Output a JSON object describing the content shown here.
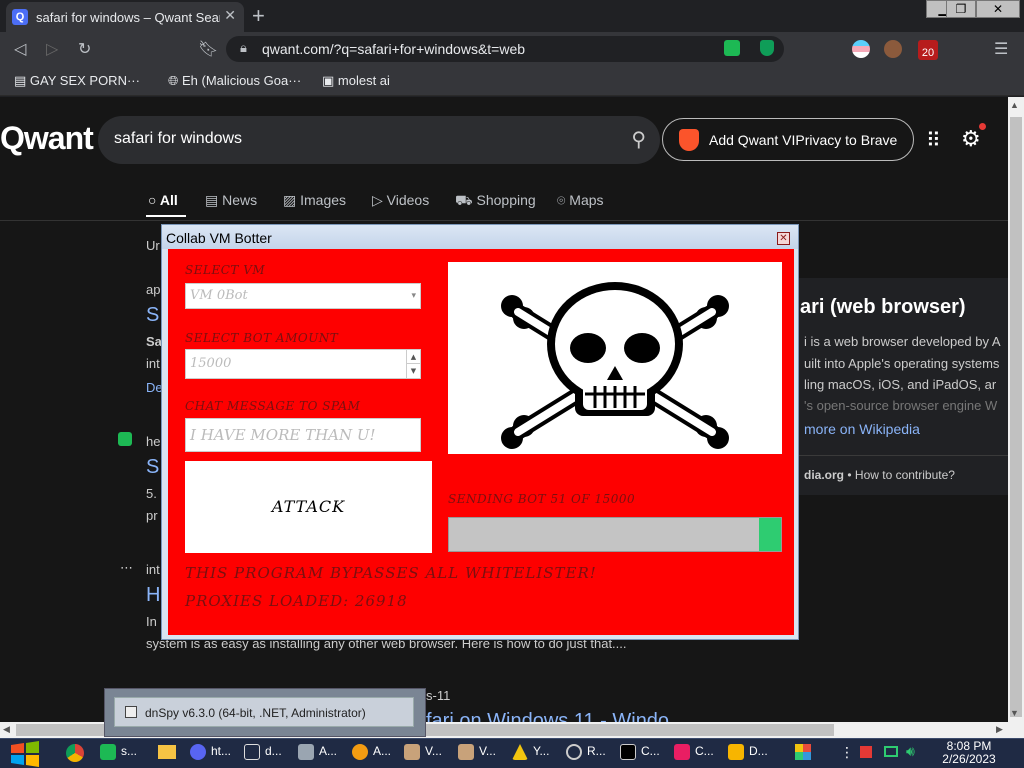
{
  "browser": {
    "tab_title": "safari for windows – Qwant Sear",
    "tab_favicon": "Q",
    "url": "qwant.com/?q=safari+for+windows&t=web",
    "badge_count": "20",
    "bookmarks": [
      "GAY SEX PORN···",
      "Eh (Malicious Goa···",
      "molest ai"
    ]
  },
  "page": {
    "logo": "Qwant",
    "search_query": "safari for windows",
    "brave_button": "Add Qwant VIPrivacy to Brave",
    "tabs": [
      "All",
      "News",
      "Images",
      "Videos",
      "Shopping",
      "Maps"
    ],
    "results": {
      "r0_label": "Ur",
      "r1_source": "ap",
      "r1_title": "S",
      "r1_snip1": "Sa",
      "r1_snip2": "int",
      "r1_snip3": "De",
      "r2_source": "he",
      "r2_title": "S",
      "r2_snip1": "5.",
      "r2_snip2": "pr",
      "r3_source": "int",
      "r3_title": "H",
      "r3_snip1": "In",
      "r3_snip2": "system is as easy as installing any other web browser. Here is how to do just that....",
      "r4_source": "s-11",
      "r4_title": "fari on Windows 11 - Windo"
    },
    "knowledge_panel": {
      "title": "ari (web browser)",
      "lines": [
        "i is a web browser developed by A",
        "uilt into Apple's operating systems",
        "ling macOS, iOS, and iPadOS, ar",
        "'s open-source browser engine W"
      ],
      "wiki_link": "more on Wikipedia",
      "source_host": "dia.org",
      "source_sep": "•",
      "source_link": "How to contribute?"
    }
  },
  "bot_window": {
    "title": "Collab VM Botter",
    "select_vm_label": "SELECT VM",
    "select_vm_value": "VM 0Bot",
    "bot_amount_label": "SELECT BOT AMOUNT",
    "bot_amount_value": "15000",
    "chat_label": "CHAT MESSAGE TO SPAM",
    "chat_value": "I HAVE MORE THAN U!",
    "attack_button": "ATTACK",
    "sending_text": "SENDING BOT 51 OF 15000",
    "progress_fraction": 0.066,
    "bypass_text": "THIS PROGRAM BYPASSES ALL WHITELISTER!",
    "proxies_text": "PROXIES LOADED: 26918"
  },
  "tooltip": {
    "dnspy": "dnSpy v6.3.0 (64-bit, .NET, Administrator)"
  },
  "taskbar": {
    "items": [
      "s...",
      "ht...",
      "d...",
      "A...",
      "A...",
      "V...",
      "V...",
      "Y...",
      "R...",
      "C...",
      "C...",
      "D..."
    ],
    "time": "8:08 PM",
    "date": "2/26/2023"
  },
  "colors": {
    "bot_bg": "#fe0000",
    "progress_fill": "#2ecc71",
    "accent_link": "#8ab4f8"
  }
}
